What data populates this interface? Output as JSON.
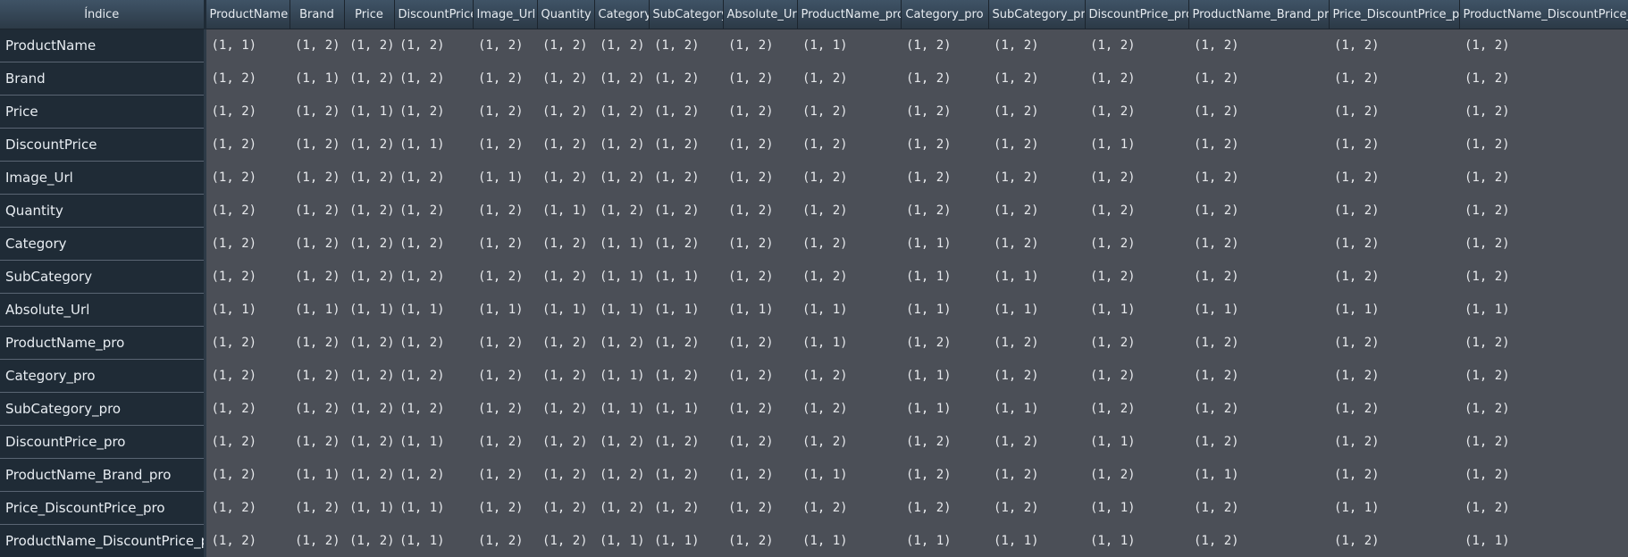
{
  "corner_label": "Índice",
  "columns": [
    "ProductName",
    "Brand",
    "Price",
    "DiscountPrice",
    "Image_Url",
    "Quantity",
    "Category",
    "SubCategory",
    "Absolute_Url",
    "ProductName_pro",
    "Category_pro",
    "SubCategory_pro",
    "DiscountPrice_pro",
    "ProductName_Brand_pro",
    "Price_DiscountPrice_pro",
    "ProductName_DiscountPrice_pro"
  ],
  "rows": [
    {
      "label": "ProductName",
      "cells": [
        "(1, 1)",
        "(1, 2)",
        "(1, 2)",
        "(1, 2)",
        "(1, 2)",
        "(1, 2)",
        "(1, 2)",
        "(1, 2)",
        "(1, 2)",
        "(1, 1)",
        "(1, 2)",
        "(1, 2)",
        "(1, 2)",
        "(1, 2)",
        "(1, 2)",
        "(1, 2)"
      ]
    },
    {
      "label": "Brand",
      "cells": [
        "(1, 2)",
        "(1, 1)",
        "(1, 2)",
        "(1, 2)",
        "(1, 2)",
        "(1, 2)",
        "(1, 2)",
        "(1, 2)",
        "(1, 2)",
        "(1, 2)",
        "(1, 2)",
        "(1, 2)",
        "(1, 2)",
        "(1, 2)",
        "(1, 2)",
        "(1, 2)"
      ]
    },
    {
      "label": "Price",
      "cells": [
        "(1, 2)",
        "(1, 2)",
        "(1, 1)",
        "(1, 2)",
        "(1, 2)",
        "(1, 2)",
        "(1, 2)",
        "(1, 2)",
        "(1, 2)",
        "(1, 2)",
        "(1, 2)",
        "(1, 2)",
        "(1, 2)",
        "(1, 2)",
        "(1, 2)",
        "(1, 2)"
      ]
    },
    {
      "label": "DiscountPrice",
      "cells": [
        "(1, 2)",
        "(1, 2)",
        "(1, 2)",
        "(1, 1)",
        "(1, 2)",
        "(1, 2)",
        "(1, 2)",
        "(1, 2)",
        "(1, 2)",
        "(1, 2)",
        "(1, 2)",
        "(1, 2)",
        "(1, 1)",
        "(1, 2)",
        "(1, 2)",
        "(1, 2)"
      ]
    },
    {
      "label": "Image_Url",
      "cells": [
        "(1, 2)",
        "(1, 2)",
        "(1, 2)",
        "(1, 2)",
        "(1, 1)",
        "(1, 2)",
        "(1, 2)",
        "(1, 2)",
        "(1, 2)",
        "(1, 2)",
        "(1, 2)",
        "(1, 2)",
        "(1, 2)",
        "(1, 2)",
        "(1, 2)",
        "(1, 2)"
      ]
    },
    {
      "label": "Quantity",
      "cells": [
        "(1, 2)",
        "(1, 2)",
        "(1, 2)",
        "(1, 2)",
        "(1, 2)",
        "(1, 1)",
        "(1, 2)",
        "(1, 2)",
        "(1, 2)",
        "(1, 2)",
        "(1, 2)",
        "(1, 2)",
        "(1, 2)",
        "(1, 2)",
        "(1, 2)",
        "(1, 2)"
      ]
    },
    {
      "label": "Category",
      "cells": [
        "(1, 2)",
        "(1, 2)",
        "(1, 2)",
        "(1, 2)",
        "(1, 2)",
        "(1, 2)",
        "(1, 1)",
        "(1, 2)",
        "(1, 2)",
        "(1, 2)",
        "(1, 1)",
        "(1, 2)",
        "(1, 2)",
        "(1, 2)",
        "(1, 2)",
        "(1, 2)"
      ]
    },
    {
      "label": "SubCategory",
      "cells": [
        "(1, 2)",
        "(1, 2)",
        "(1, 2)",
        "(1, 2)",
        "(1, 2)",
        "(1, 2)",
        "(1, 1)",
        "(1, 1)",
        "(1, 2)",
        "(1, 2)",
        "(1, 1)",
        "(1, 1)",
        "(1, 2)",
        "(1, 2)",
        "(1, 2)",
        "(1, 2)"
      ]
    },
    {
      "label": "Absolute_Url",
      "cells": [
        "(1, 1)",
        "(1, 1)",
        "(1, 1)",
        "(1, 1)",
        "(1, 1)",
        "(1, 1)",
        "(1, 1)",
        "(1, 1)",
        "(1, 1)",
        "(1, 1)",
        "(1, 1)",
        "(1, 1)",
        "(1, 1)",
        "(1, 1)",
        "(1, 1)",
        "(1, 1)"
      ]
    },
    {
      "label": "ProductName_pro",
      "cells": [
        "(1, 2)",
        "(1, 2)",
        "(1, 2)",
        "(1, 2)",
        "(1, 2)",
        "(1, 2)",
        "(1, 2)",
        "(1, 2)",
        "(1, 2)",
        "(1, 1)",
        "(1, 2)",
        "(1, 2)",
        "(1, 2)",
        "(1, 2)",
        "(1, 2)",
        "(1, 2)"
      ]
    },
    {
      "label": "Category_pro",
      "cells": [
        "(1, 2)",
        "(1, 2)",
        "(1, 2)",
        "(1, 2)",
        "(1, 2)",
        "(1, 2)",
        "(1, 1)",
        "(1, 2)",
        "(1, 2)",
        "(1, 2)",
        "(1, 1)",
        "(1, 2)",
        "(1, 2)",
        "(1, 2)",
        "(1, 2)",
        "(1, 2)"
      ]
    },
    {
      "label": "SubCategory_pro",
      "cells": [
        "(1, 2)",
        "(1, 2)",
        "(1, 2)",
        "(1, 2)",
        "(1, 2)",
        "(1, 2)",
        "(1, 1)",
        "(1, 1)",
        "(1, 2)",
        "(1, 2)",
        "(1, 1)",
        "(1, 1)",
        "(1, 2)",
        "(1, 2)",
        "(1, 2)",
        "(1, 2)"
      ]
    },
    {
      "label": "DiscountPrice_pro",
      "cells": [
        "(1, 2)",
        "(1, 2)",
        "(1, 2)",
        "(1, 1)",
        "(1, 2)",
        "(1, 2)",
        "(1, 2)",
        "(1, 2)",
        "(1, 2)",
        "(1, 2)",
        "(1, 2)",
        "(1, 2)",
        "(1, 1)",
        "(1, 2)",
        "(1, 2)",
        "(1, 2)"
      ]
    },
    {
      "label": "ProductName_Brand_pro",
      "cells": [
        "(1, 2)",
        "(1, 1)",
        "(1, 2)",
        "(1, 2)",
        "(1, 2)",
        "(1, 2)",
        "(1, 2)",
        "(1, 2)",
        "(1, 2)",
        "(1, 1)",
        "(1, 2)",
        "(1, 2)",
        "(1, 2)",
        "(1, 1)",
        "(1, 2)",
        "(1, 2)"
      ]
    },
    {
      "label": "Price_DiscountPrice_pro",
      "cells": [
        "(1, 2)",
        "(1, 2)",
        "(1, 1)",
        "(1, 1)",
        "(1, 2)",
        "(1, 2)",
        "(1, 2)",
        "(1, 2)",
        "(1, 2)",
        "(1, 2)",
        "(1, 2)",
        "(1, 2)",
        "(1, 1)",
        "(1, 2)",
        "(1, 1)",
        "(1, 2)"
      ]
    },
    {
      "label": "ProductName_DiscountPrice_pro",
      "cells": [
        "(1, 2)",
        "(1, 2)",
        "(1, 2)",
        "(1, 1)",
        "(1, 2)",
        "(1, 2)",
        "(1, 1)",
        "(1, 1)",
        "(1, 2)",
        "(1, 1)",
        "(1, 1)",
        "(1, 1)",
        "(1, 1)",
        "(1, 2)",
        "(1, 2)",
        "(1, 1)"
      ]
    }
  ]
}
